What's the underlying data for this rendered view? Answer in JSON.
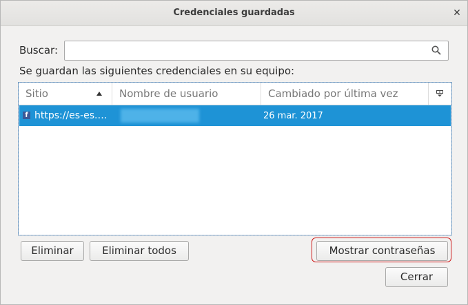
{
  "window": {
    "title": "Credenciales guardadas",
    "close_glyph": "✕"
  },
  "search": {
    "label": "Buscar:",
    "value": "",
    "placeholder": "",
    "icon": "search-icon"
  },
  "info_text": "Se guardan las siguientes credenciales en su equipo:",
  "table": {
    "columns": [
      "Sitio",
      "Nombre de usuario",
      "Cambiado por última vez"
    ],
    "sort_column": "Sitio",
    "sort_direction": "ascending",
    "rows": [
      {
        "site": "https://es-es.…",
        "site_icon": "facebook-icon",
        "site_icon_glyph": "f",
        "username": "",
        "changed": "26 mar. 2017",
        "selected": true
      }
    ]
  },
  "buttons": {
    "delete": "Eliminar",
    "delete_all": "Eliminar todos",
    "show_passwords": "Mostrar contraseñas",
    "close": "Cerrar"
  },
  "colors": {
    "selection": "#1e93d6",
    "highlight_ring": "#cc1818",
    "facebook": "#3b5998"
  }
}
